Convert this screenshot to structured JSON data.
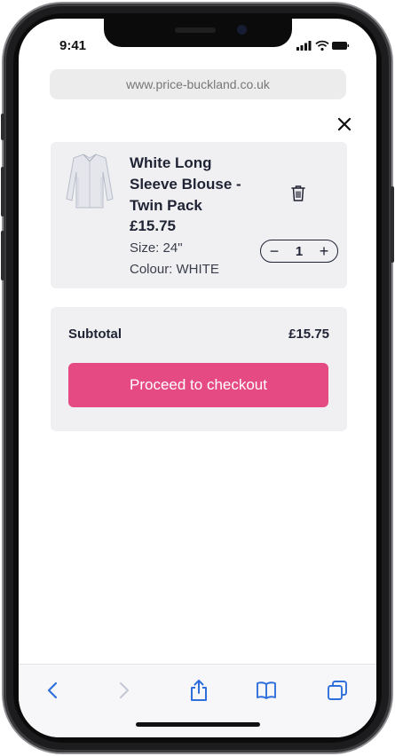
{
  "status_bar": {
    "time": "9:41"
  },
  "browser": {
    "url": "www.price-buckland.co.uk"
  },
  "cart": {
    "item": {
      "name": "White Long Sleeve Blouse - Twin Pack",
      "price": "£15.75",
      "size": "Size: 24\"",
      "colour": "Colour: WHITE",
      "quantity": "1",
      "qty_minus": "−",
      "qty_plus": "+"
    },
    "summary": {
      "subtotal_label": "Subtotal",
      "subtotal_value": "£15.75",
      "checkout_label": "Proceed to checkout"
    }
  },
  "toolbar": {
    "icons": [
      "back-icon",
      "forward-icon",
      "share-icon",
      "bookmarks-icon",
      "tabs-icon"
    ]
  },
  "colors": {
    "accent": "#e54a82",
    "card_bg": "#f0f0f3",
    "text_dark": "#1f2333",
    "toolbar_icon": "#2f6fdb"
  }
}
